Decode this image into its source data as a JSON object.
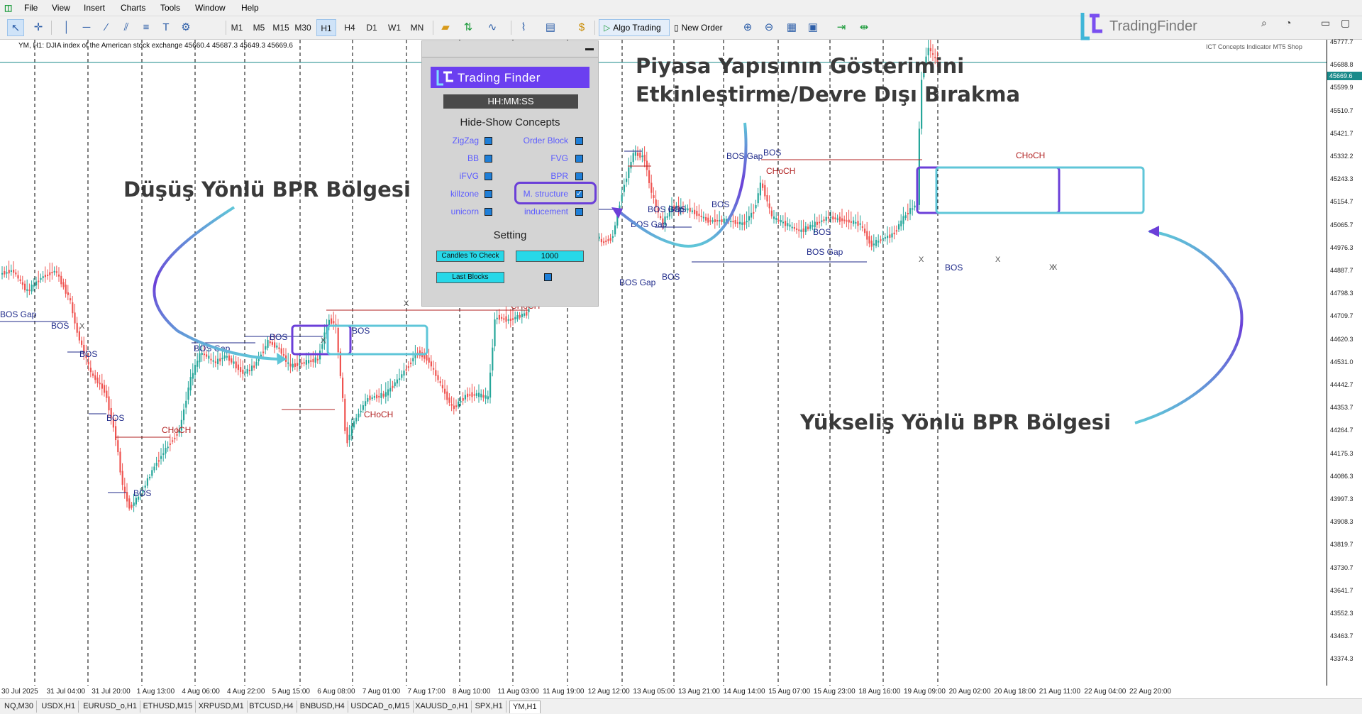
{
  "menu": [
    "File",
    "View",
    "Insert",
    "Charts",
    "Tools",
    "Window",
    "Help"
  ],
  "toolbar": {
    "timeframes": [
      "M1",
      "M5",
      "M15",
      "M30",
      "H1",
      "H4",
      "D1",
      "W1",
      "MN"
    ],
    "active_timeframe": "H1",
    "algo_trading": "Algo Trading",
    "new_order": "New Order"
  },
  "brand": {
    "name": "TradingFinder"
  },
  "chart": {
    "title": "YM, H1:  DJIA index of the American stock exchange  45660.4 45687.3 45649.3 45669.6",
    "indicator_label": "ICT Concepts Indicator MT5 Shop"
  },
  "panel": {
    "logo_text": "Trading Finder",
    "clock": "HH:MM:SS",
    "concepts_title": "Hide-Show Concepts",
    "left_options": [
      "ZigZag",
      "BB",
      "iFVG",
      "killzone",
      "unicorn"
    ],
    "right_options": [
      "Order Block",
      "FVG",
      "BPR",
      "M. structure",
      "inducement"
    ],
    "setting_title": "Setting",
    "candles_label": "Candles To Check",
    "candles_value": "1000",
    "last_blocks_label": "Last Blocks"
  },
  "annotations": {
    "bearish_bpr": "Düşüş Yönlü BPR Bölgesi",
    "market_structure_line1": "Piyasa Yapısının Gösterimini",
    "market_structure_line2": "Etkinleştirme/Devre Dışı Bırakma",
    "bullish_bpr": "Yükseliş Yönlü BPR Bölgesi"
  },
  "chart_labels": {
    "bos": "BOS",
    "bos_gap": "BOS Gap",
    "choch": "CHoCH",
    "x": "X"
  },
  "price_axis": [
    "45777.7",
    "45688.8",
    "45599.9",
    "45510.7",
    "45421.7",
    "45332.2",
    "45243.3",
    "45154.7",
    "45065.7",
    "44976.3",
    "44887.7",
    "44798.3",
    "44709.7",
    "44620.3",
    "44531.0",
    "44442.7",
    "44353.7",
    "44264.7",
    "44175.3",
    "44086.3",
    "43997.3",
    "43908.3",
    "43819.7",
    "43730.7",
    "43641.7",
    "43552.3",
    "43463.7",
    "43374.3"
  ],
  "current_price": "45669.6",
  "date_axis": [
    "30 Jul 2025",
    "31 Jul 04:00",
    "31 Jul 20:00",
    "1 Aug 13:00",
    "4 Aug 06:00",
    "4 Aug 22:00",
    "5 Aug 15:00",
    "6 Aug 08:00",
    "7 Aug 01:00",
    "7 Aug 17:00",
    "8 Aug 10:00",
    "11 Aug 03:00",
    "11 Aug 19:00",
    "12 Aug 12:00",
    "13 Aug 05:00",
    "13 Aug 21:00",
    "14 Aug 14:00",
    "15 Aug 07:00",
    "15 Aug 23:00",
    "18 Aug 16:00",
    "19 Aug 09:00",
    "20 Aug 02:00",
    "20 Aug 18:00",
    "21 Aug 11:00",
    "22 Aug 04:00",
    "22 Aug 20:00"
  ],
  "bottom_tabs": [
    "NQ,M30",
    "USDX,H1",
    "EURUSD_o,H1",
    "ETHUSD,M15",
    "XRPUSD,M1",
    "BTCUSD,H4",
    "BNBUSD,H4",
    "USDCAD_o,M15",
    "XAUUSD_o,H1",
    "SPX,H1",
    "YM,H1"
  ],
  "active_tab": "YM,H1",
  "colors": {
    "bull": "#26a69a",
    "bear": "#ef5350",
    "bos": "#1f2a8a",
    "choch": "#b22222",
    "highlight": "#5fc6d8",
    "purple": "#6b3fd8"
  }
}
